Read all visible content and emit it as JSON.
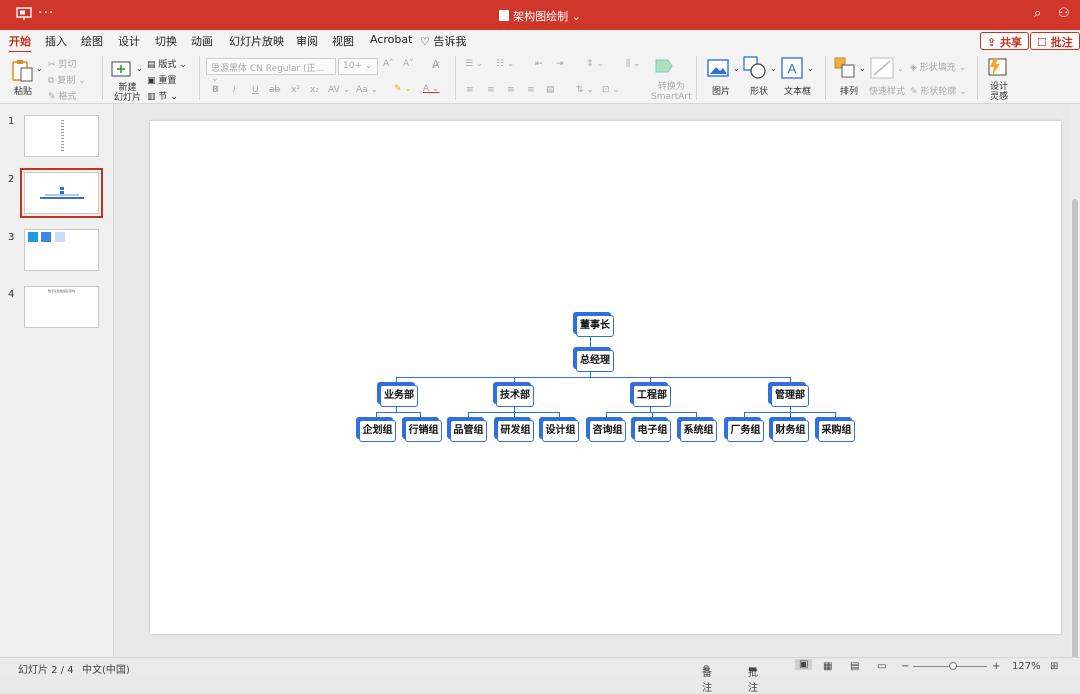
{
  "titlebar": {
    "title": "架构图绘制",
    "more": "···"
  },
  "tabs": [
    "开始",
    "插入",
    "绘图",
    "设计",
    "切换",
    "动画",
    "幻灯片放映",
    "审阅",
    "视图",
    "Acrobat",
    "告诉我"
  ],
  "share": {
    "share": "共享",
    "comment": "批注"
  },
  "ribbon": {
    "paste": "粘贴",
    "cut": "剪切",
    "copy": "复制",
    "format": "格式",
    "new_slide_1": "新建",
    "new_slide_2": "幻灯片",
    "layout": "版式",
    "reset": "重置",
    "section": "节",
    "font": "思源黑体 CN Regular (正...",
    "size": "10+",
    "convert_1": "转换为",
    "convert_2": "SmartArt",
    "picture": "图片",
    "shape": "形状",
    "textbox": "文本框",
    "arrange": "排列",
    "quickstyle": "快速样式",
    "shape_fill": "形状填充",
    "shape_outline": "形状轮廓",
    "design_1": "设计",
    "design_2": "灵感"
  },
  "slides": [
    "1",
    "2",
    "3",
    "4"
  ],
  "slide4_thumb_text": "数字化赋能组织架构",
  "org": {
    "root": "董事长",
    "gm": "总经理",
    "depts": [
      {
        "name": "业务部",
        "groups": [
          "企划组",
          "行销组"
        ]
      },
      {
        "name": "技术部",
        "groups": [
          "品管组",
          "研发组",
          "设计组"
        ]
      },
      {
        "name": "工程部",
        "groups": [
          "咨询组",
          "电子组",
          "系统组"
        ]
      },
      {
        "name": "管理部",
        "groups": [
          "厂务组",
          "财务组",
          "采购组"
        ]
      }
    ]
  },
  "status": {
    "slide": "幻灯片 2 / 4",
    "lang": "中文(中国)",
    "notes": "备注",
    "comments": "批注",
    "zoom": "127%"
  },
  "colors": {
    "accent": "#c4341e",
    "node_border": "#2f6fe0"
  }
}
